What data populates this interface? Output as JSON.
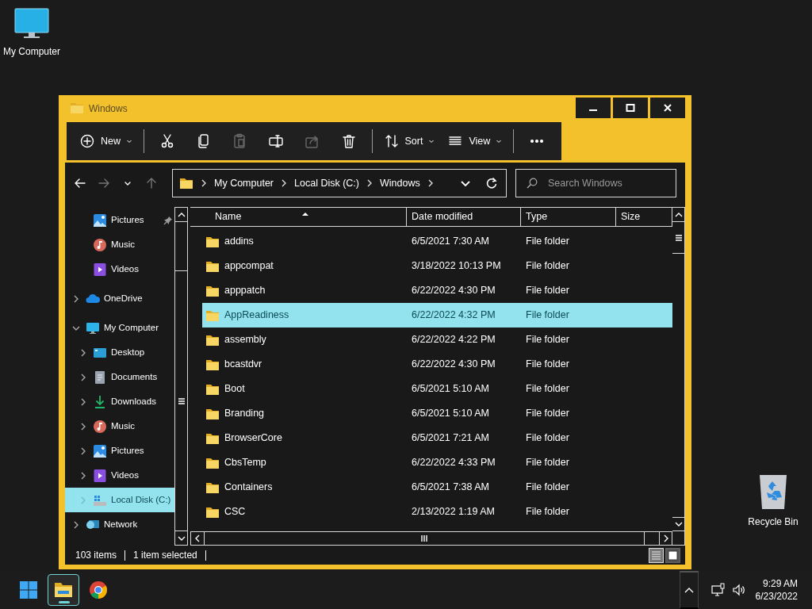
{
  "desktop_icons": [
    {
      "kind": "computer",
      "label": "My Computer"
    },
    {
      "kind": "recycle_bin",
      "label": "Recycle Bin"
    }
  ],
  "window": {
    "title": "Windows"
  },
  "toolbar": [
    [
      {
        "kind": "new",
        "label": "New",
        "disabled": false
      }
    ],
    [
      {
        "kind": "cut",
        "disabled": false
      },
      {
        "kind": "copy",
        "disabled": false
      },
      {
        "kind": "paste",
        "disabled": true
      },
      {
        "kind": "rename",
        "disabled": false
      },
      {
        "kind": "share",
        "disabled": true
      },
      {
        "kind": "delete",
        "disabled": false
      }
    ],
    [
      {
        "kind": "sort",
        "label": "Sort",
        "disabled": false
      },
      {
        "kind": "view",
        "label": "View",
        "disabled": false
      }
    ],
    [
      {
        "kind": "more",
        "disabled": false
      }
    ]
  ],
  "nav_buttons": [
    {
      "kind": "back",
      "disabled": false
    },
    {
      "kind": "forward",
      "disabled": true
    },
    {
      "kind": "recent",
      "disabled": false
    },
    {
      "kind": "up",
      "disabled": true
    }
  ],
  "address": {
    "breadcrumbs": [
      "My Computer",
      "Local Disk (C:)",
      "Windows"
    ]
  },
  "search": {
    "placeholder": "Search Windows"
  },
  "nav": {
    "quick_access": [
      {
        "kind": "pictures",
        "label": "Pictures",
        "pinned": true,
        "selected": false
      },
      {
        "kind": "music",
        "label": "Music",
        "pinned": false,
        "selected": false
      },
      {
        "kind": "videos",
        "label": "Videos",
        "pinned": false,
        "selected": false
      }
    ],
    "tree": [
      {
        "kind": "onedrive",
        "label": "OneDrive",
        "expanded": false,
        "selected": false
      },
      {
        "kind": "computer",
        "label": "My Computer",
        "expanded": true,
        "selected": false,
        "children": [
          {
            "kind": "desktop",
            "label": "Desktop",
            "expanded": false,
            "selected": false
          },
          {
            "kind": "documents",
            "label": "Documents",
            "expanded": false,
            "selected": false
          },
          {
            "kind": "downloads",
            "label": "Downloads",
            "expanded": false,
            "selected": false
          },
          {
            "kind": "music",
            "label": "Music",
            "expanded": false,
            "selected": false
          },
          {
            "kind": "pictures",
            "label": "Pictures",
            "expanded": false,
            "selected": false
          },
          {
            "kind": "videos",
            "label": "Videos",
            "expanded": false,
            "selected": false
          },
          {
            "kind": "drive",
            "label": "Local Disk (C:)",
            "expanded": false,
            "selected": true
          }
        ]
      },
      {
        "kind": "network",
        "label": "Network",
        "expanded": false,
        "selected": false
      }
    ]
  },
  "columns": [
    {
      "label": "Name",
      "sorted": true
    },
    {
      "label": "Date modified",
      "sorted": false
    },
    {
      "label": "Type",
      "sorted": false
    },
    {
      "label": "Size",
      "sorted": false
    }
  ],
  "rows": [
    {
      "name": "addins",
      "date": "6/5/2021 7:30 AM",
      "type": "File folder",
      "selected": false
    },
    {
      "name": "appcompat",
      "date": "3/18/2022 10:13 PM",
      "type": "File folder",
      "selected": false
    },
    {
      "name": "apppatch",
      "date": "6/22/2022 4:30 PM",
      "type": "File folder",
      "selected": false
    },
    {
      "name": "AppReadiness",
      "date": "6/22/2022 4:32 PM",
      "type": "File folder",
      "selected": true
    },
    {
      "name": "assembly",
      "date": "6/22/2022 4:22 PM",
      "type": "File folder",
      "selected": false
    },
    {
      "name": "bcastdvr",
      "date": "6/22/2022 4:30 PM",
      "type": "File folder",
      "selected": false
    },
    {
      "name": "Boot",
      "date": "6/5/2021 5:10 AM",
      "type": "File folder",
      "selected": false
    },
    {
      "name": "Branding",
      "date": "6/5/2021 5:10 AM",
      "type": "File folder",
      "selected": false
    },
    {
      "name": "BrowserCore",
      "date": "6/5/2021 7:21 AM",
      "type": "File folder",
      "selected": false
    },
    {
      "name": "CbsTemp",
      "date": "6/22/2022 4:33 PM",
      "type": "File folder",
      "selected": false
    },
    {
      "name": "Containers",
      "date": "6/5/2021 7:38 AM",
      "type": "File folder",
      "selected": false
    },
    {
      "name": "CSC",
      "date": "2/13/2022 1:19 AM",
      "type": "File folder",
      "selected": false
    }
  ],
  "status_bar": {
    "item_count": "103 items",
    "selection": "1 item selected"
  },
  "view_buttons": [
    {
      "kind": "details",
      "selected": true
    },
    {
      "kind": "large_icons",
      "selected": false
    }
  ],
  "taskbar": {
    "apps": [
      {
        "kind": "start",
        "active": false
      },
      {
        "kind": "explorer",
        "active": true
      },
      {
        "kind": "chrome",
        "active": false
      }
    ],
    "time": "9:29 AM",
    "date": "6/23/2022"
  }
}
